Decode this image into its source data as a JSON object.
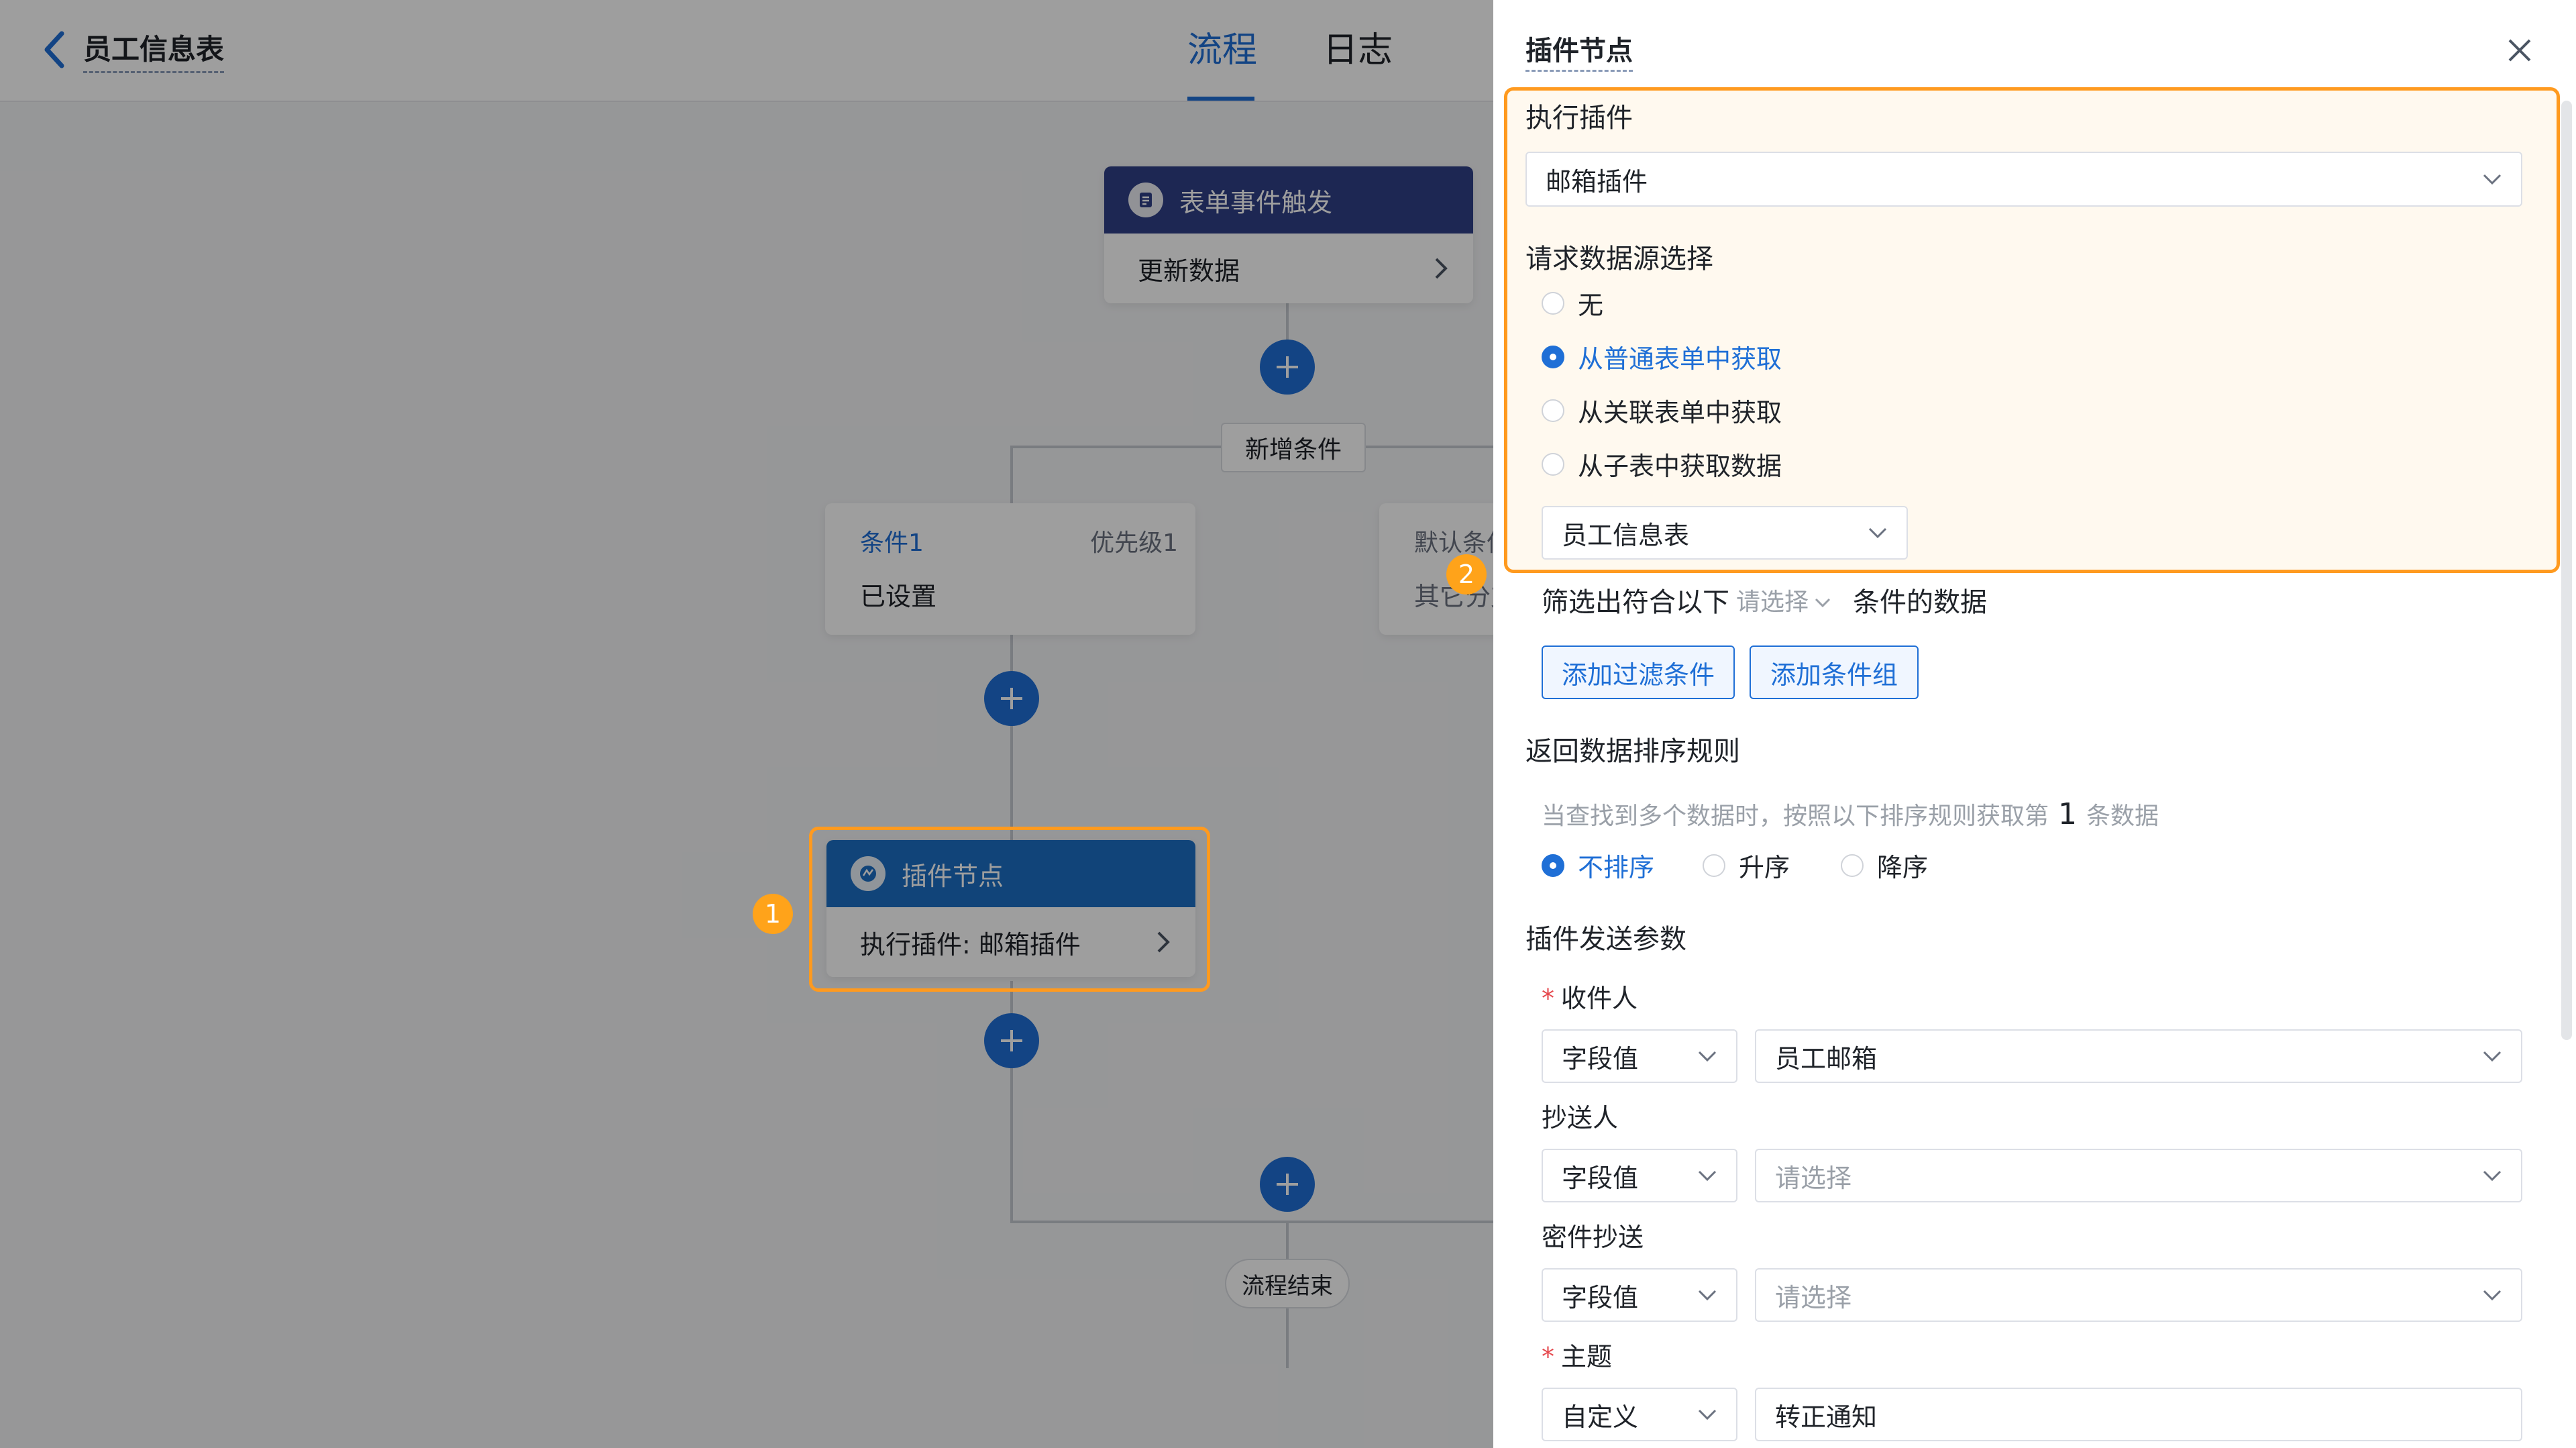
{
  "header": {
    "title": "员工信息表",
    "tabs": [
      {
        "label": "流程",
        "active": true
      },
      {
        "label": "日志",
        "active": false
      }
    ]
  },
  "canvas": {
    "trigger_node": {
      "title": "表单事件触发",
      "body": "更新数据"
    },
    "add_condition_label": "新增条件",
    "condition_1": {
      "name": "条件1",
      "priority": "优先级1",
      "status": "已设置"
    },
    "default_condition": {
      "name": "默认条件",
      "status": "其它分支"
    },
    "plugin_node": {
      "title": "插件节点",
      "body": "执行插件: 邮箱插件"
    },
    "end_label": "流程结束",
    "badges": [
      "1",
      "2"
    ]
  },
  "panel": {
    "title": "插件节点",
    "exec_plugin_label": "执行插件",
    "exec_plugin_value": "邮箱插件",
    "source_label": "请求数据源选择",
    "source_options": [
      {
        "label": "无",
        "checked": false
      },
      {
        "label": "从普通表单中获取",
        "checked": true
      },
      {
        "label": "从关联表单中获取",
        "checked": false
      },
      {
        "label": "从子表中获取数据",
        "checked": false
      }
    ],
    "source_form_value": "员工信息表",
    "filter": {
      "prefix": "筛选出符合以下",
      "select": "请选择",
      "suffix": "条件的数据",
      "add_filter": "添加过滤条件",
      "add_group": "添加条件组"
    },
    "sort": {
      "label": "返回数据排序规则",
      "hint_prefix": "当查找到多个数据时，按照以下排序规则获取第",
      "hint_number": "1",
      "hint_suffix": "条数据",
      "options": [
        {
          "label": "不排序",
          "checked": true
        },
        {
          "label": "升序",
          "checked": false
        },
        {
          "label": "降序",
          "checked": false
        }
      ]
    },
    "params_label": "插件发送参数",
    "required_mark": "*",
    "params": [
      {
        "label": "收件人",
        "required": true,
        "type": "字段值",
        "value": "员工邮箱",
        "placeholder": false
      },
      {
        "label": "抄送人",
        "required": false,
        "type": "字段值",
        "value": "请选择",
        "placeholder": true
      },
      {
        "label": "密件抄送",
        "required": false,
        "type": "字段值",
        "value": "请选择",
        "placeholder": true
      },
      {
        "label": "主题",
        "required": true,
        "type": "自定义",
        "value": "转正通知",
        "placeholder": false
      }
    ]
  },
  "colors": {
    "primary": "#1f6fd6",
    "highlight": "#ff9a1f",
    "badge": "#ffa31a"
  }
}
